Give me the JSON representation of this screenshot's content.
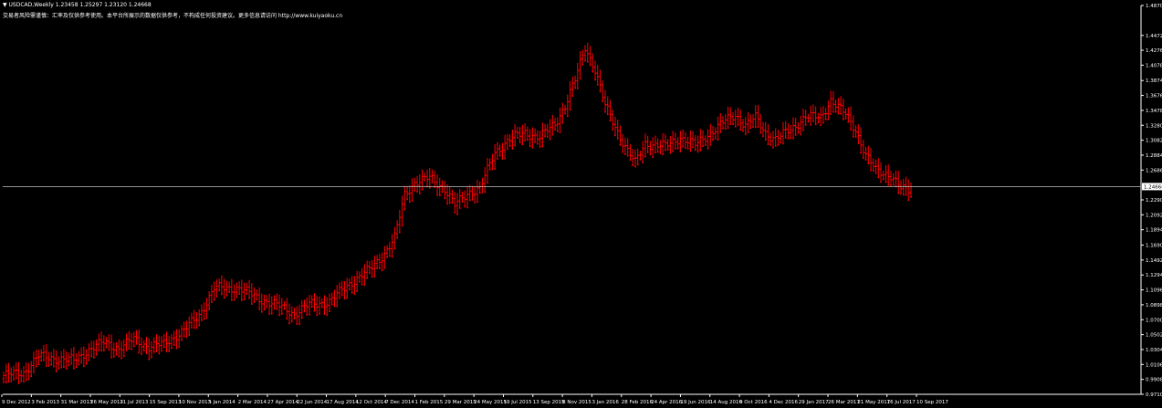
{
  "header": {
    "title": "▼ USDCAD,Weekly  1.23458 1.25297 1.23120 1.24668",
    "description": "交易者风险需谨慎：汇率及仅供参考使用。本平台所展示的数据仅供参考，不构成任何投资建议。更多信息请访问 http://www.kuiyaoku.cn"
  },
  "chart_data": {
    "type": "bar",
    "symbol": "USDCAD",
    "timeframe": "Weekly",
    "ohlc_header": {
      "open": 1.23458,
      "high": 1.25297,
      "low": 1.2312,
      "close": 1.24668
    },
    "current_price": 1.24668,
    "current_price_label": "1.24668",
    "ylim": [
      0.971,
      1.487
    ],
    "y_ticks": [
      "1.48700",
      "1.44720",
      "1.42760",
      "1.40780",
      "1.38740",
      "1.36760",
      "1.34780",
      "1.32800",
      "1.30820",
      "1.28840",
      "1.26860",
      "1.24668",
      "1.22900",
      "1.20920",
      "1.18940",
      "1.16900",
      "1.14920",
      "1.12940",
      "1.10960",
      "1.08980",
      "1.07000",
      "1.05020",
      "1.03040",
      "1.01060",
      "0.99080",
      "0.97100"
    ],
    "x_labels": [
      "9 Dec 2012",
      "3 Feb 2013",
      "31 Mar 2013",
      "26 May 2013",
      "21 Jul 2013",
      "15 Sep 2013",
      "10 Nov 2013",
      "5 Jan 2014",
      "2 Mar 2014",
      "27 Apr 2014",
      "22 Jun 2014",
      "17 Aug 2014",
      "12 Oct 2014",
      "7 Dec 2014",
      "1 Feb 2015",
      "29 Mar 2015",
      "24 May 2015",
      "19 Jul 2015",
      "13 Sep 2015",
      "8 Nov 2015",
      "3 Jan 2016",
      "28 Feb 2016",
      "24 Apr 2016",
      "19 Jun 2016",
      "14 Aug 2016",
      "9 Oct 2016",
      "4 Dec 2016",
      "29 Jan 2017",
      "26 Mar 2017",
      "21 May 2017",
      "16 Jul 2017",
      "10 Sep 2017"
    ],
    "anchors": [
      [
        0,
        0.996
      ],
      [
        8,
        1.0
      ],
      [
        14,
        1.022
      ],
      [
        22,
        1.018
      ],
      [
        28,
        1.016
      ],
      [
        34,
        1.03
      ],
      [
        40,
        1.04
      ],
      [
        46,
        1.032
      ],
      [
        52,
        1.044
      ],
      [
        58,
        1.034
      ],
      [
        64,
        1.038
      ],
      [
        72,
        1.056
      ],
      [
        78,
        1.076
      ],
      [
        84,
        1.112
      ],
      [
        94,
        1.112
      ],
      [
        102,
        1.098
      ],
      [
        110,
        1.088
      ],
      [
        116,
        1.078
      ],
      [
        122,
        1.09
      ],
      [
        130,
        1.094
      ],
      [
        138,
        1.118
      ],
      [
        146,
        1.136
      ],
      [
        152,
        1.158
      ],
      [
        156,
        1.178
      ],
      [
        160,
        1.236
      ],
      [
        164,
        1.252
      ],
      [
        170,
        1.258
      ],
      [
        176,
        1.244
      ],
      [
        180,
        1.222
      ],
      [
        186,
        1.24
      ],
      [
        190,
        1.244
      ],
      [
        196,
        1.292
      ],
      [
        202,
        1.31
      ],
      [
        208,
        1.318
      ],
      [
        214,
        1.312
      ],
      [
        220,
        1.33
      ],
      [
        224,
        1.354
      ],
      [
        228,
        1.388
      ],
      [
        232,
        1.432
      ],
      [
        236,
        1.402
      ],
      [
        240,
        1.354
      ],
      [
        244,
        1.326
      ],
      [
        248,
        1.3
      ],
      [
        252,
        1.278
      ],
      [
        256,
        1.304
      ],
      [
        264,
        1.3
      ],
      [
        270,
        1.312
      ],
      [
        276,
        1.302
      ],
      [
        282,
        1.318
      ],
      [
        288,
        1.334
      ],
      [
        292,
        1.342
      ],
      [
        296,
        1.328
      ],
      [
        300,
        1.338
      ],
      [
        304,
        1.318
      ],
      [
        308,
        1.31
      ],
      [
        314,
        1.322
      ],
      [
        320,
        1.34
      ],
      [
        326,
        1.338
      ],
      [
        330,
        1.362
      ],
      [
        336,
        1.342
      ],
      [
        340,
        1.322
      ],
      [
        344,
        1.288
      ],
      [
        348,
        1.268
      ],
      [
        354,
        1.262
      ],
      [
        358,
        1.244
      ],
      [
        362,
        1.24
      ]
    ],
    "bar_color": "#ff0000",
    "grid": false
  }
}
